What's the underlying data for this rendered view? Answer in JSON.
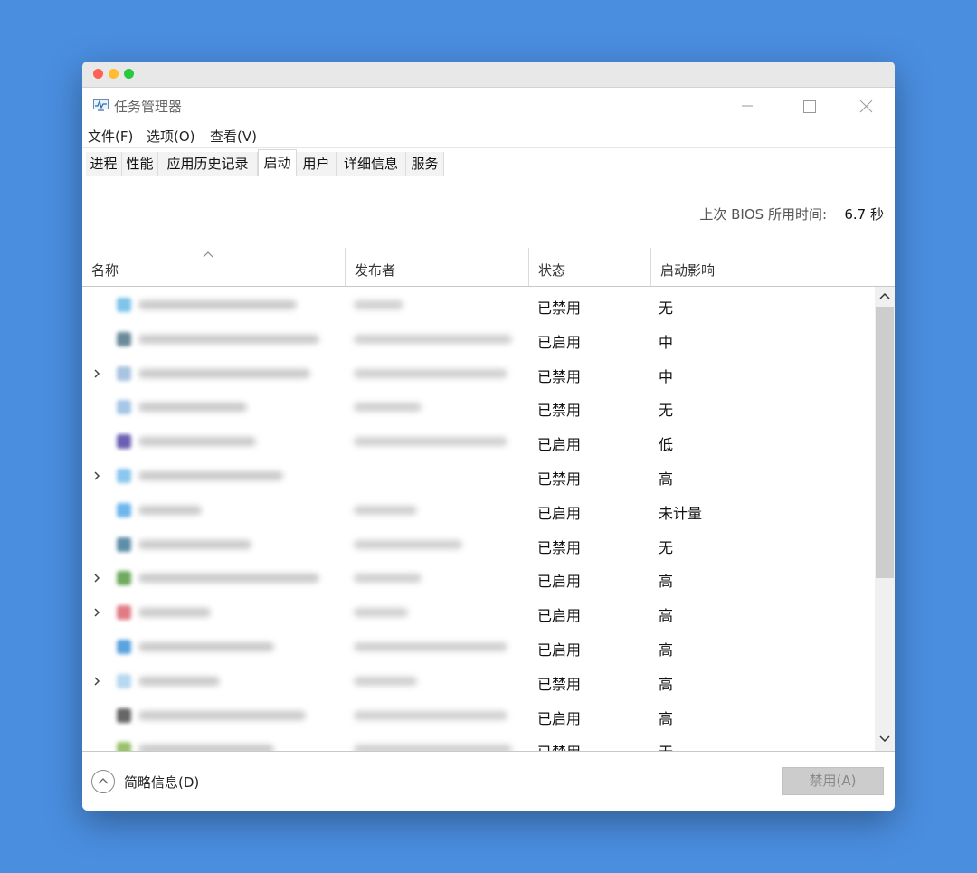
{
  "window": {
    "title": "任务管理器",
    "controls": {
      "minimize": "—",
      "maximize": "☐",
      "close": "✕"
    }
  },
  "menu": [
    "文件(F)",
    "选项(O)",
    "查看(V)"
  ],
  "tabs": [
    {
      "label": "进程",
      "active": false
    },
    {
      "label": "性能",
      "active": false
    },
    {
      "label": "应用历史记录",
      "active": false
    },
    {
      "label": "启动",
      "active": true
    },
    {
      "label": "用户",
      "active": false
    },
    {
      "label": "详细信息",
      "active": false
    },
    {
      "label": "服务",
      "active": false
    }
  ],
  "bios": {
    "label": "上次 BIOS 所用时间:",
    "value": "6.7 秒"
  },
  "columns": {
    "name": "名称",
    "publisher": "发布者",
    "status": "状态",
    "impact": "启动影响"
  },
  "rows": [
    {
      "expandable": false,
      "status": "已禁用",
      "impact": "无",
      "icon_color": "#7fc4ea"
    },
    {
      "expandable": false,
      "status": "已启用",
      "impact": "中",
      "icon_color": "#6a8a9a"
    },
    {
      "expandable": true,
      "status": "已禁用",
      "impact": "中",
      "icon_color": "#a9c3e0"
    },
    {
      "expandable": false,
      "status": "已禁用",
      "impact": "无",
      "icon_color": "#a8c6e6"
    },
    {
      "expandable": false,
      "status": "已启用",
      "impact": "低",
      "icon_color": "#6b5fb3"
    },
    {
      "expandable": true,
      "status": "已禁用",
      "impact": "高",
      "icon_color": "#8cc6ef"
    },
    {
      "expandable": false,
      "status": "已启用",
      "impact": "未计量",
      "icon_color": "#6fb6ee"
    },
    {
      "expandable": false,
      "status": "已禁用",
      "impact": "无",
      "icon_color": "#5f8fa8"
    },
    {
      "expandable": true,
      "status": "已启用",
      "impact": "高",
      "icon_color": "#6faa5f"
    },
    {
      "expandable": true,
      "status": "已启用",
      "impact": "高",
      "icon_color": "#e07b84"
    },
    {
      "expandable": false,
      "status": "已启用",
      "impact": "高",
      "icon_color": "#5ba3de"
    },
    {
      "expandable": true,
      "status": "已禁用",
      "impact": "高",
      "icon_color": "#b8d8f0"
    },
    {
      "expandable": false,
      "status": "已启用",
      "impact": "高",
      "icon_color": "#666666"
    },
    {
      "expandable": false,
      "status": "已禁用",
      "impact": "无",
      "icon_color": "#98c36a"
    }
  ],
  "footer": {
    "fewer_details": "简略信息(D)",
    "disable_button": "禁用(A)"
  }
}
